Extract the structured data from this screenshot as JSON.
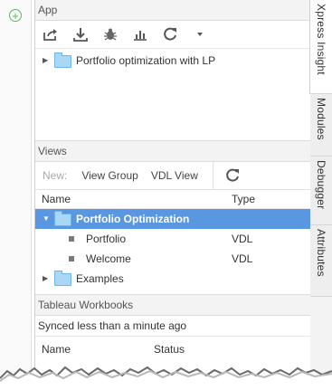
{
  "gutter": {
    "add_icon": "plus-circle-icon"
  },
  "app": {
    "header": "App",
    "toolbar": [
      {
        "name": "export-icon"
      },
      {
        "name": "download-icon"
      },
      {
        "name": "bug-icon"
      },
      {
        "name": "bar-chart-icon"
      },
      {
        "name": "refresh-icon"
      },
      {
        "name": "dropdown-caret-icon"
      }
    ],
    "tree": [
      {
        "label": "Portfolio optimization with LP",
        "expanded": false
      }
    ]
  },
  "views": {
    "header": "Views",
    "toolbar": {
      "new_label": "New:",
      "view_group_label": "View Group",
      "vdl_view_label": "VDL View"
    },
    "columns": {
      "name": "Name",
      "type": "Type"
    },
    "rows": [
      {
        "label": "Portfolio Optimization",
        "type": "",
        "kind": "folder",
        "expanded": true,
        "selected": true
      },
      {
        "label": "Portfolio",
        "type": "VDL",
        "kind": "view"
      },
      {
        "label": "Welcome",
        "type": "VDL",
        "kind": "view"
      },
      {
        "label": "Examples",
        "type": "",
        "kind": "folder",
        "expanded": false
      }
    ]
  },
  "tableau": {
    "header": "Tableau Workbooks",
    "sync_status": "Synced less than a minute ago",
    "columns": {
      "name": "Name",
      "status": "Status"
    }
  },
  "tabs": [
    {
      "label": "Xpress Insight",
      "active": true
    },
    {
      "label": "Modules",
      "active": false
    },
    {
      "label": "Debugger",
      "active": false
    },
    {
      "label": "Attributes",
      "active": false
    }
  ],
  "colors": {
    "selection": "#5a97e2",
    "folder": "#a9d8f7",
    "accent_green": "#5cb85c"
  }
}
